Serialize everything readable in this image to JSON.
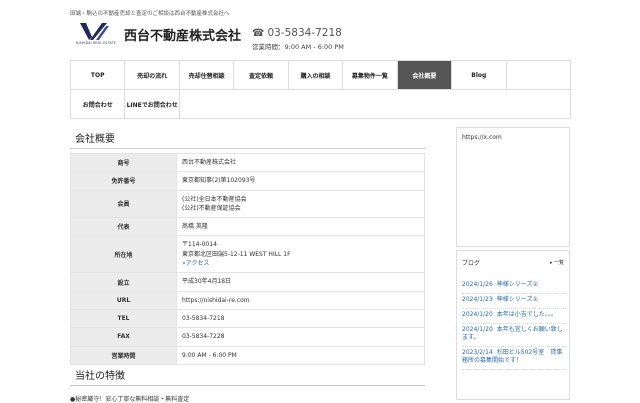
{
  "header": {
    "top_note": "田端・駒込の不動産売却と査定のご相談は西台不動産株式会社へ",
    "logo_text": "NISHIDAI REAL ESTATE",
    "company_name": "西台不動産株式会社",
    "phone": "03-5834-7218",
    "hours": "営業時間：9:00 AM - 6:00 PM"
  },
  "nav": {
    "row1": [
      "TOP",
      "売却の流れ",
      "売却住替相談",
      "査定依頼",
      "購入の相談",
      "募集物件一覧",
      "会社概要",
      "Blog"
    ],
    "row2": [
      "お問合わせ",
      "LINEでお問合わせ"
    ],
    "active": "会社概要"
  },
  "main": {
    "section_title": "会社概要",
    "rows": [
      {
        "label": "商号",
        "value": "西台不動産株式会社"
      },
      {
        "label": "免許番号",
        "value": "東京都知事(2)第102093号"
      },
      {
        "label": "会員",
        "lines": [
          "(公社)全日本不動産協会",
          "(公社)不動産保証協会"
        ]
      },
      {
        "label": "代表",
        "value": "髙橋 英隆"
      },
      {
        "label": "所在地",
        "lines": [
          "〒114-0014",
          "東京都北区田端5-12-11 WEST HILL 1F"
        ],
        "link": "»アクセス"
      },
      {
        "label": "設立",
        "value": "平成30年4月18日"
      },
      {
        "label": "URL",
        "value": "https://nishidai-re.com"
      },
      {
        "label": "TEL",
        "value": "03-5834-7218"
      },
      {
        "label": "FAX",
        "value": "03-5834-7228"
      },
      {
        "label": "営業時間",
        "value": "9:00 AM - 6:00 PM"
      }
    ],
    "section2_title": "当社の特徴",
    "bottom_text": "●秘密厳守！安心丁寧な無料相談・無料査定"
  },
  "sidebar": {
    "url_text": "https://x.com",
    "blog_title": "ブログ",
    "blog_more": "▸ 一覧",
    "blog_items": [
      {
        "date": "2024/1/26",
        "title": "神様シリーズ②"
      },
      {
        "date": "2024/1/23",
        "title": "神様シリーズ①"
      },
      {
        "date": "2024/1/20",
        "title": "本年は小吉でした。。。"
      },
      {
        "date": "2024/1/20",
        "title": "本年も宜しくお願い致します。"
      },
      {
        "date": "2023/2/14",
        "title": "杉田ビル502号室　貸事務所の募集開始です！"
      }
    ]
  }
}
